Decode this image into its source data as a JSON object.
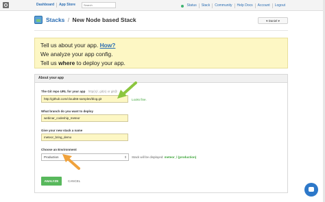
{
  "topbar": {
    "nav": [
      "Dashboard",
      "App Store"
    ],
    "search_placeholder": "Search",
    "status": "Status",
    "right_links": [
      "Stack",
      "Community",
      "Help Docs",
      "Account",
      "Logout"
    ]
  },
  "header": {
    "breadcrumb_root": "Stacks",
    "breadcrumb_sep": "/",
    "title": "New Node based Stack",
    "user_button": "▾ Daniel ▾"
  },
  "notice": {
    "line1_prefix": "Tell us about your app.",
    "line1_link": "How?",
    "line2_prefix": "We analyze your app config.",
    "line3_a": "Tell us",
    "line3_emph": "where",
    "line3_b": "to deploy your app."
  },
  "form": {
    "panel_title": "About your app",
    "repo_label": "The Git repo URL for your app",
    "repo_hint": "http(s)/, git(s) or git@",
    "repo_value": "http://github.com/cloud66-samples/blog.git",
    "repo_ok": "Looks fine.",
    "branch_label": "What branch do you want to deploy",
    "branch_value": "webinar_codeship_meteor",
    "name_label": "Give your new stack a name",
    "name_value": "meteor_bring_demo",
    "env_label": "Choose an Environment",
    "env_value": "Production",
    "env_note_prefix": "Stack will be displayed:",
    "env_note_value": "meteor_l (production)",
    "analyze": "ANALYZE",
    "cancel": "CANCEL"
  },
  "colors": {
    "accent": "#2a6db3",
    "highlight": "#fdf7c4",
    "success": "#58b85c",
    "arrow_green": "#8cc63f",
    "arrow_orange": "#f0a23c"
  },
  "icons": [
    "app-logo-icon",
    "stack-logo-icon",
    "status-dot-icon",
    "caret-down-icon",
    "chat-icon",
    "arrow-icon"
  ]
}
